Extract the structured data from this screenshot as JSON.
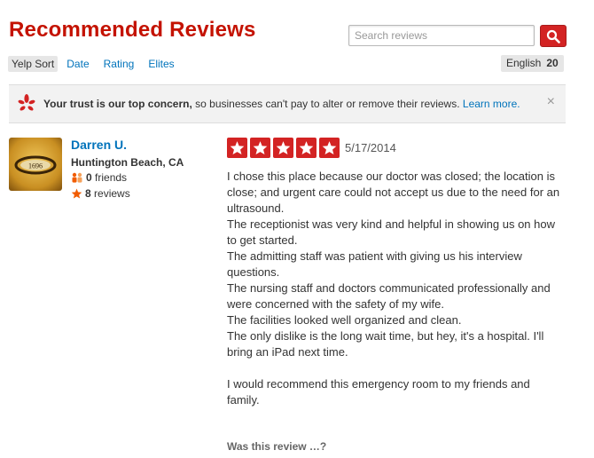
{
  "header": {
    "title": "Recommended Reviews",
    "search_placeholder": "Search reviews"
  },
  "sort": {
    "options": [
      "Yelp Sort",
      "Date",
      "Rating",
      "Elites"
    ],
    "active": "Yelp Sort"
  },
  "language": {
    "label": "English",
    "count": "20"
  },
  "trust_banner": {
    "bold_text": "Your trust is our top concern,",
    "text": " so businesses can't pay to alter or remove their reviews. ",
    "link": "Learn more.",
    "close": "×"
  },
  "reviewer": {
    "name": "Darren U.",
    "location": "Huntington Beach, CA",
    "friends_count": "0",
    "friends_label": " friends",
    "reviews_count": "8",
    "reviews_label": " reviews",
    "avatar_text": "1696"
  },
  "review": {
    "rating": 5,
    "date": "5/17/2014",
    "paragraphs": [
      "I chose this place because our doctor was closed; the location is close; and urgent care could not accept us due to the need for an ultrasound.",
      "The receptionist was very kind and helpful in showing us on how to get started.",
      "The admitting staff was patient with giving us his interview questions.",
      "The nursing staff and doctors communicated professionally and were concerned with the safety of my wife.",
      "The facilities looked well organized and clean.",
      "The only dislike is the long wait time, but hey, it's a hospital. I'll bring an iPad next time.",
      "",
      "I would recommend this emergency room to my friends and family."
    ],
    "useful_prompt": "Was this review …?"
  },
  "colors": {
    "brand_red": "#c41200",
    "star_red": "#d32323",
    "link_blue": "#0073bb"
  }
}
